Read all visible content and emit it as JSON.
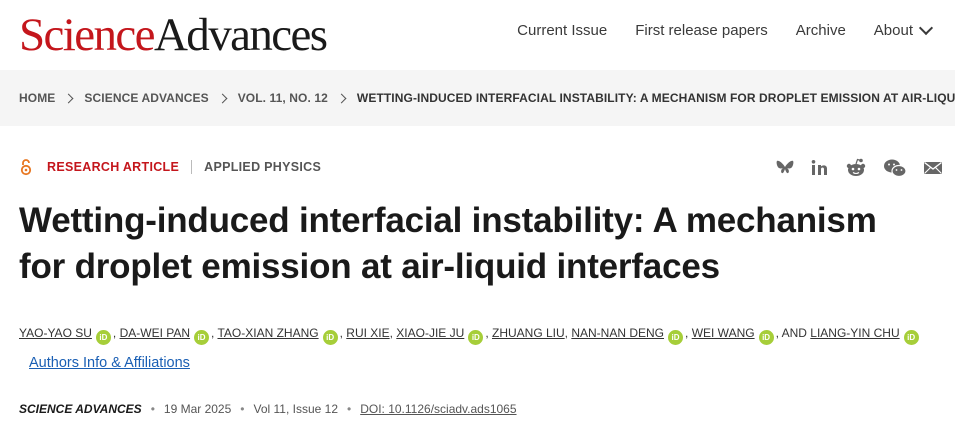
{
  "header": {
    "logo_part1": "Science",
    "logo_part2": "Advances",
    "nav": [
      "Current Issue",
      "First release papers",
      "Archive",
      "About"
    ]
  },
  "breadcrumb": [
    "HOME",
    "SCIENCE ADVANCES",
    "VOL. 11, NO. 12",
    "WETTING-INDUCED INTERFACIAL INSTABILITY: A MECHANISM FOR DROPLET EMISSION AT AIR-LIQUID..."
  ],
  "article": {
    "type": "RESEARCH ARTICLE",
    "subject": "APPLIED PHYSICS",
    "title": "Wetting-induced interfacial instability: A mechanism for droplet emission at air-liquid interfaces",
    "authors": [
      "YAO-YAO SU",
      "DA-WEI PAN",
      "TAO-XIAN ZHANG",
      "RUI XIE",
      "XIAO-JIE JU",
      "ZHUANG LIU",
      "NAN-NAN DENG",
      "WEI WANG",
      "LIANG-YIN CHU"
    ],
    "and_text": "AND",
    "orcid_label": "iD",
    "affiliations_link": "Authors Info & Affiliations",
    "journal": "SCIENCE ADVANCES",
    "date": "19 Mar 2025",
    "volume": "Vol 11, Issue 12",
    "doi": "DOI: 10.1126/sciadv.ads1065"
  },
  "share_icons": [
    "bluesky-icon",
    "linkedin-icon",
    "reddit-icon",
    "wechat-icon",
    "email-icon"
  ],
  "colors": {
    "brand_red": "#c4161c",
    "orcid_green": "#a6ce39",
    "link_blue": "#1a5fb4"
  }
}
